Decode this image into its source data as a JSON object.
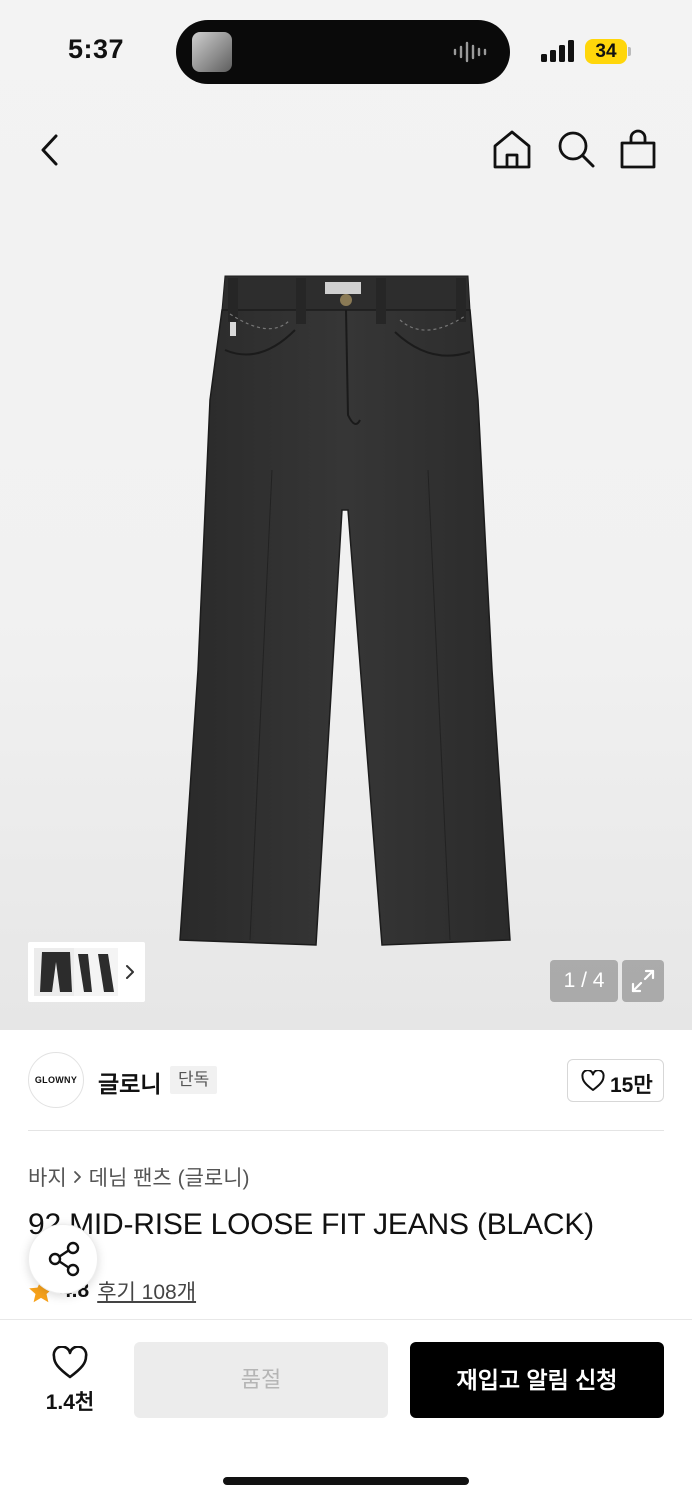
{
  "status_bar": {
    "time": "5:37",
    "battery": "34"
  },
  "nav": {
    "back_icon": "chevron-left-icon",
    "home_icon": "home-icon",
    "search_icon": "search-icon",
    "bag_icon": "shopping-bag-icon"
  },
  "gallery": {
    "pager": "1 / 4",
    "current_index": 1,
    "total": 4
  },
  "brand": {
    "logo_text": "GLOWNY",
    "name": "글로니",
    "tag": "단독",
    "like_count": "15만"
  },
  "breadcrumb": {
    "items": [
      "바지",
      "데님 팬츠 (글로니)"
    ]
  },
  "product": {
    "title": "92 MID-RISE LOOSE FIT JEANS (BLACK)",
    "rating": "4.8",
    "reviews": "후기 108개"
  },
  "bottom_bar": {
    "wish_count": "1.4천",
    "soldout_label": "품절",
    "restock_label": "재입고 알림 신청"
  },
  "colors": {
    "accent_star": "#f7a21b",
    "battery": "#ffd60a",
    "primary_button": "#000000"
  }
}
